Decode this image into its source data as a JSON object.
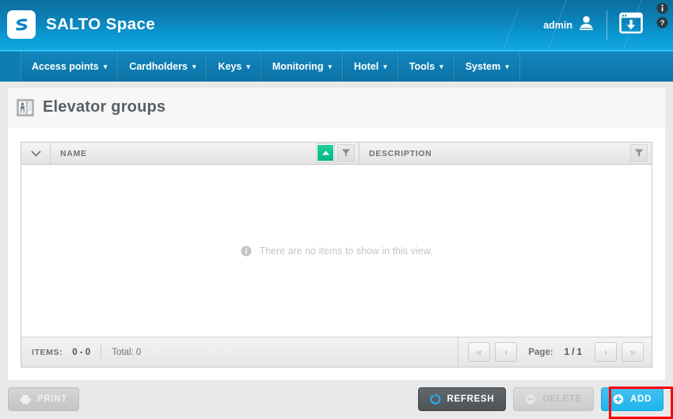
{
  "header": {
    "brand": "SALTO Space",
    "logo_icon": "salto-s-logo",
    "admin_label": "admin",
    "user_icon": "user-icon",
    "download_icon": "download-window-icon",
    "info_icon": "info-icon",
    "help_icon": "help-icon"
  },
  "nav": {
    "items": [
      {
        "label": "Access points",
        "caret": "▾"
      },
      {
        "label": "Cardholders",
        "caret": "▾"
      },
      {
        "label": "Keys",
        "caret": "▾"
      },
      {
        "label": "Monitoring",
        "caret": "▾"
      },
      {
        "label": "Hotel",
        "caret": "▾"
      },
      {
        "label": "Tools",
        "caret": "▾"
      },
      {
        "label": "System",
        "caret": "▾"
      }
    ]
  },
  "page": {
    "title": "Elevator groups",
    "title_icon": "elevator-icon"
  },
  "grid": {
    "expander_icon": "chevron-down-icon",
    "columns": [
      {
        "label": "NAME",
        "sort_icon": "sort-ascending-icon",
        "filter_icon": "filter-icon"
      },
      {
        "label": "DESCRIPTION",
        "filter_icon": "filter-icon"
      }
    ],
    "rows": [],
    "empty_message": "There are no items to show in this view.",
    "empty_icon": "info-icon",
    "footer": {
      "items_label": "ITEMS:",
      "items_range": "0 - 0",
      "total_label": "Total: 0",
      "page_label": "Page:",
      "page_value": "1 / 1",
      "first_icon": "«",
      "prev_icon": "‹",
      "next_icon": "›",
      "last_icon": "»"
    }
  },
  "toolbar": {
    "print_label": "PRINT",
    "print_icon": "printer-icon",
    "refresh_label": "REFRESH",
    "refresh_icon": "refresh-icon",
    "delete_label": "DELETE",
    "delete_icon": "minus-circle-icon",
    "add_label": "ADD",
    "add_icon": "plus-circle-icon"
  },
  "annotation": {
    "highlight_target": "add-button",
    "highlight_color": "#ff0000"
  },
  "colors": {
    "brand_blue": "#0b9ad4",
    "nav_blue": "#0e7db2",
    "accent_cyan": "#2cc3f2",
    "add_blue": "#1db4ec",
    "sort_green": "#00b486",
    "highlight_red": "#ff0000"
  }
}
